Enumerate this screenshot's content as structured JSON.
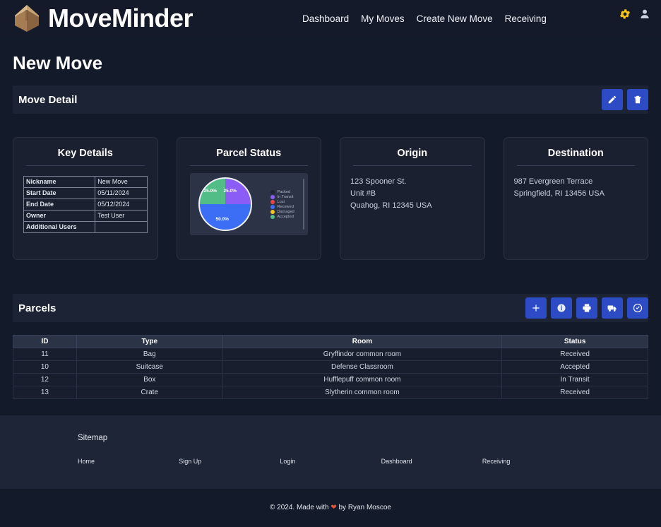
{
  "header": {
    "brand": "MoveMinder",
    "logo_icon": "package-box-icon",
    "nav": [
      {
        "label": "Dashboard"
      },
      {
        "label": "My Moves"
      },
      {
        "label": "Create New Move"
      },
      {
        "label": "Receiving"
      }
    ],
    "settings_icon": "gear-icon",
    "account_icon": "user-icon",
    "settings_color": "#f5c518",
    "account_color": "#c9cfdd"
  },
  "page": {
    "title": "New Move"
  },
  "move_detail": {
    "title": "Move Detail",
    "actions": [
      {
        "name": "edit-move-button",
        "icon": "pencil-icon"
      },
      {
        "name": "delete-move-button",
        "icon": "trash-icon"
      }
    ]
  },
  "key_details": {
    "title": "Key Details",
    "rows": [
      {
        "key": "Nickname",
        "value": "New Move"
      },
      {
        "key": "Start Date",
        "value": "05/11/2024"
      },
      {
        "key": "End Date",
        "value": "05/12/2024"
      },
      {
        "key": "Owner",
        "value": "Test User"
      },
      {
        "key": "Additional Users",
        "value": ""
      }
    ]
  },
  "parcel_status": {
    "title": "Parcel Status"
  },
  "chart_data": {
    "type": "pie",
    "title": "Parcel Status",
    "categories": [
      "Packed",
      "In Transit",
      "Lost",
      "Received",
      "Damaged",
      "Accepted"
    ],
    "values": [
      0,
      25.0,
      0,
      50.0,
      0,
      25.0
    ],
    "labels": [
      "25.0%",
      "50.0%",
      "25.0%"
    ],
    "colors": {
      "Packed": "#1f2430",
      "In Transit": "#8b5cf6",
      "Lost": "#ef4444",
      "Received": "#3b6ef5",
      "Damaged": "#f5c518",
      "Accepted": "#52bd87"
    },
    "legend_position": "right",
    "legend": [
      {
        "label": "Packed",
        "color": "#1f2430"
      },
      {
        "label": "In Transit",
        "color": "#8b5cf6"
      },
      {
        "label": "Lost",
        "color": "#ef4444"
      },
      {
        "label": "Received",
        "color": "#3b6ef5"
      },
      {
        "label": "Damaged",
        "color": "#f5c518"
      },
      {
        "label": "Accepted",
        "color": "#52bd87"
      }
    ],
    "slice_labels": {
      "in_transit": "25.0%",
      "received": "50.0%",
      "accepted": "25.0%"
    }
  },
  "origin": {
    "title": "Origin",
    "lines": [
      "123 Spooner St.",
      "Unit #B",
      "Quahog, RI 12345 USA"
    ]
  },
  "destination": {
    "title": "Destination",
    "lines": [
      "987 Evergreen Terrace",
      "Springfield, RI 13456 USA"
    ]
  },
  "parcels": {
    "title": "Parcels",
    "actions": [
      {
        "name": "add-parcel-button",
        "icon": "plus-icon"
      },
      {
        "name": "parcel-info-button",
        "icon": "info-circle-icon"
      },
      {
        "name": "print-labels-button",
        "icon": "printer-icon"
      },
      {
        "name": "ship-parcels-button",
        "icon": "truck-icon"
      },
      {
        "name": "accept-parcels-button",
        "icon": "check-circle-icon"
      }
    ],
    "columns": [
      "ID",
      "Type",
      "Room",
      "Status"
    ],
    "rows": [
      {
        "id": "11",
        "type": "Bag",
        "room": "Gryffindor common room",
        "status": "Received"
      },
      {
        "id": "10",
        "type": "Suitcase",
        "room": "Defense Classroom",
        "status": "Accepted"
      },
      {
        "id": "12",
        "type": "Box",
        "room": "Hufflepuff common room",
        "status": "In Transit"
      },
      {
        "id": "13",
        "type": "Crate",
        "room": "Slytherin common room",
        "status": "Received"
      }
    ]
  },
  "footer": {
    "sitemap_title": "Sitemap",
    "links": [
      {
        "label": "Home"
      },
      {
        "label": "Sign Up"
      },
      {
        "label": "Login"
      },
      {
        "label": "Dashboard"
      },
      {
        "label": "Receiving"
      }
    ],
    "copyright_prefix": "© 2024. Made with ",
    "heart": "❤",
    "copyright_suffix": " by Ryan Moscoe"
  }
}
